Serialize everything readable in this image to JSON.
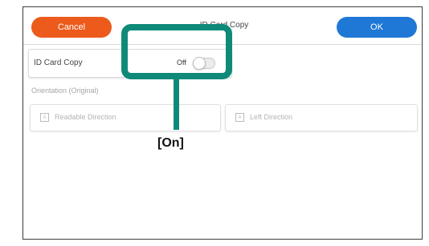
{
  "header": {
    "cancel_label": "Cancel",
    "title": "ID Card Copy",
    "ok_label": "OK"
  },
  "id_card_row": {
    "label": "ID Card Copy",
    "toggle_state_text": "Off"
  },
  "orientation": {
    "section_label": "Orientation (Original)",
    "options": [
      {
        "label": "Readable Direction",
        "icon": "readable-direction-icon"
      },
      {
        "label": "Left Direction",
        "icon": "left-direction-icon"
      }
    ]
  },
  "annotation": {
    "callout_text": "[On]"
  },
  "colors": {
    "cancel": "#ec5a1c",
    "ok": "#1f77d6",
    "highlight": "#0f8a79"
  }
}
